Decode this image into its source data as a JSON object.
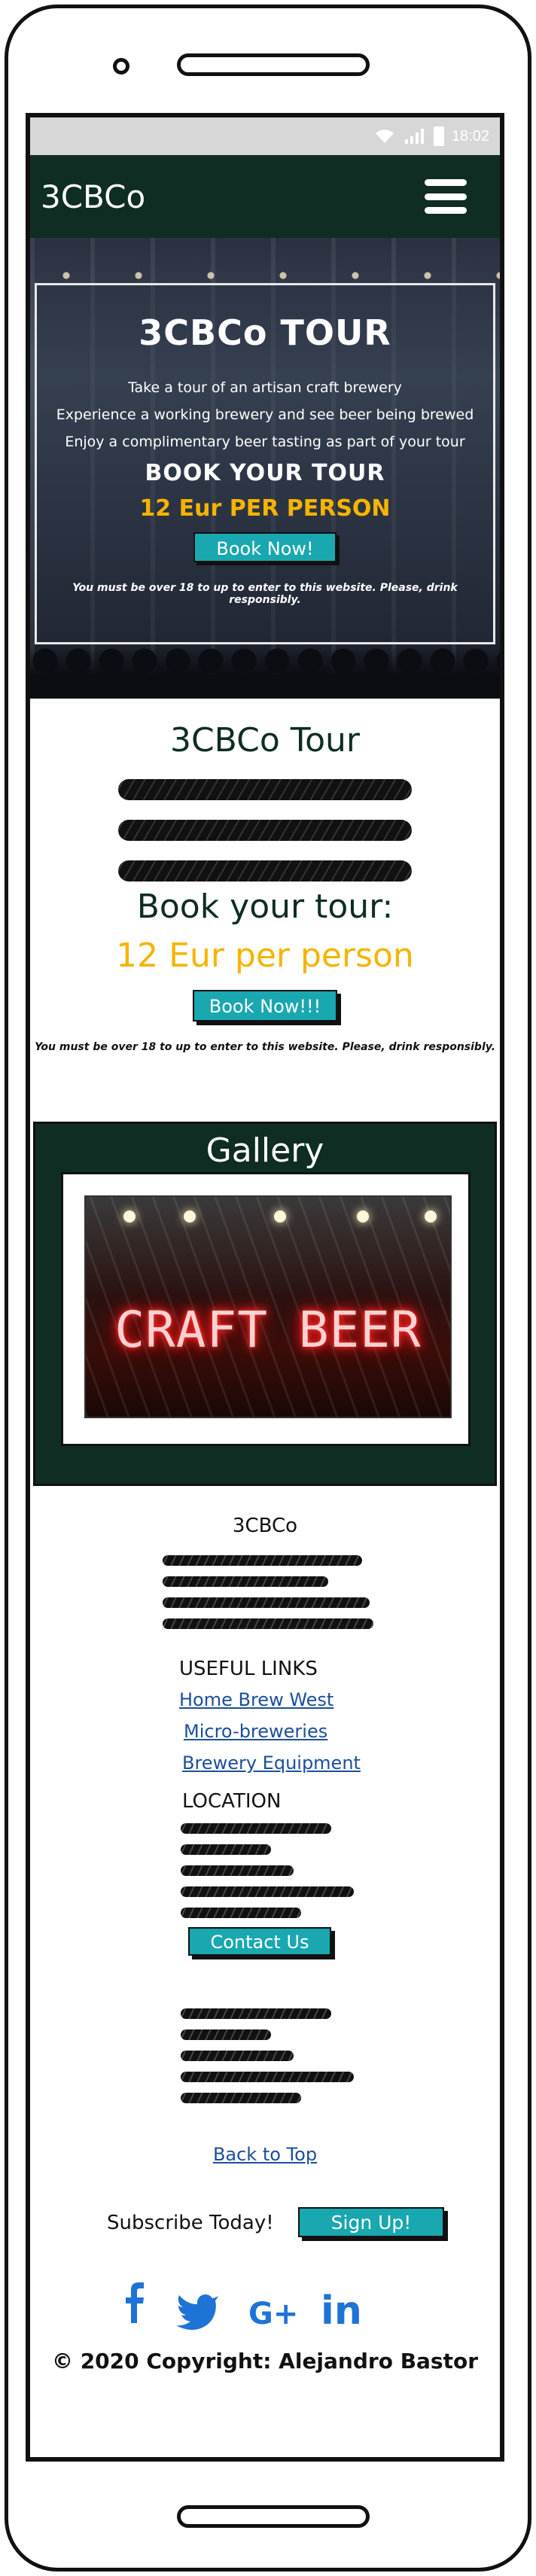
{
  "status_bar": {
    "time": "18:02"
  },
  "navbar": {
    "brand": "3CBCo"
  },
  "hero": {
    "title": "3CBCo TOUR",
    "lines": [
      "Take a tour of an artisan craft brewery",
      "Experience a working brewery and see beer being brewed",
      "Enjoy a complimentary beer tasting as part of your tour"
    ],
    "book_heading": "BOOK YOUR TOUR",
    "price": "12 Eur PER PERSON",
    "button": "Book Now!",
    "warning": "You must be over 18 to up to enter to this website. Please, drink responsibly."
  },
  "tour": {
    "title": "3CBCo Tour",
    "subtitle": "Book your tour:",
    "price": "12 Eur per person",
    "button": "Book Now!!!",
    "warning": "You must be over 18 to up to enter to this website. Please, drink responsibly."
  },
  "gallery": {
    "title": "Gallery",
    "neon_sign": "CRAFT BEER"
  },
  "footer": {
    "brand": "3CBCo",
    "useful_links_heading": "USEFUL LINKS",
    "links": [
      "Home Brew West",
      "Micro-breweries",
      "Brewery Equipment"
    ],
    "location_heading": "LOCATION",
    "contact_button": "Contact Us",
    "back_to_top": "Back to Top",
    "subscribe_label": "Subscribe Today!",
    "signup_button": "Sign Up!",
    "social": [
      "facebook-icon",
      "twitter-icon",
      "google-plus-icon",
      "linkedin-icon"
    ],
    "copyright_symbol": "©",
    "copyright": "2020 Copyright: Alejandro Bastor"
  },
  "colors": {
    "dark_green": "#0f2d22",
    "teal": "#19a7b0",
    "gold": "#f5b400",
    "link_blue": "#1b4f9c",
    "social_blue": "#1e73d6"
  }
}
